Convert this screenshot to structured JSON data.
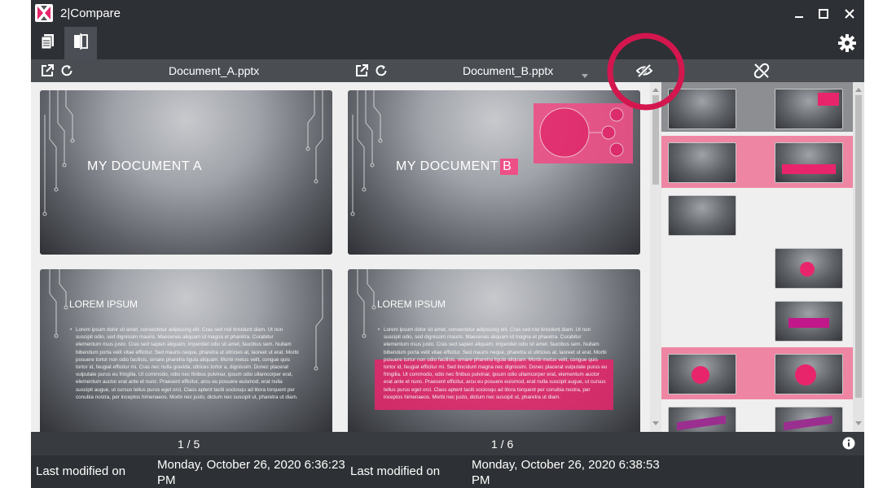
{
  "window": {
    "title": "2|Compare"
  },
  "toolbar": {
    "tabs": [
      "documents-tab",
      "compare-tab"
    ]
  },
  "left_doc": {
    "filename": "Document_A.pptx",
    "page": "1 / 5",
    "modified_label": "Last modified on",
    "modified_value": "Monday, October 26, 2020 6:36:23 PM",
    "slides": [
      {
        "title": "MY DOCUMENT A"
      },
      {
        "heading": "LOREM IPSUM",
        "body": "Lorem ipsum dolor sit amet, consectetur adipiscing elit. Cras sed nisl tincidunt diam. Ut non suscipit odio, sed dignissim mauris. Maecenas aliquam id magna et pharetra. Curabitur elementum risus justo. Cras sed sapien aliquam, imperdiet odio sit amet, faucibus sem. Nullam bibendum porta velit vitae efficitur. Sed mauris neque, pharetra ut ultricies at, laoreet ut erat. Morbi posuere tortor non odio facilisis, ornare pharetra ligula aliquam. Morbi metus velit, congue quis tortor id, feugiat efficitur mi. Cras nec nulla gravida, ultrices tortor a, dignissim. Donec placerat vulputate purus eu fringilla. Ut commodo, odio nec finibus pulvinar, ipsum odio ullamcorper erat, elementum auctor erat ante et nunc. Praesent efficitur, arcu eu posuere euismod, erat nulla suscipit augue, ut cursus tellus purus eget orci. Class aptent taciti sociosqu ad litora torquent per conubia nostra, per inceptos himenaeos. Morbi nec justo, dictum nec suscipit ut, pharetra ut diam."
      }
    ]
  },
  "right_doc": {
    "filename": "Document_B.pptx",
    "page": "1 / 6",
    "modified_label": "Last modified on",
    "modified_value": "Monday, October 26, 2020 6:38:53 PM",
    "slides": [
      {
        "title": "MY DOCUMENT",
        "title_suffix": "B"
      },
      {
        "heading": "LOREM IPSUM",
        "body": "Lorem ipsum dolor sit amet, consectetur adipiscing elit. Cras sed nisl tincidunt diam. Ut non suscipit odio, sed dignissim mauris. Maecenas aliquam id magna et pharetra. Curabitur elementum risus justo. Cras sed sapien aliquam, imperdiet odio sit amet, faucibus sem. Nullam bibendum porta velit vitae efficitur. Sed mauris neque, pharetra ut ultricies at, laoreet ut erat. Morbi posuere tortor non odio facilisis, ornare pharetra ligula aliquam. Morbi metus velit, congue quis tortor id, feugiat efficitur mi. Sed tincidunt magna nec dignissim. Donec placerat vulputate purus eu fringilla. Ut commodo, odio nec finibus pulvinar, ipsum odio ullamcorper erat, elementum auctor erat ante et nunc. Praesent efficitur, arcu eu posuere euismod, erat nulla suscipit augue, ut cursus tellus purus eget orci. Class aptent taciti sociosqu ad litora torquent per conubia nostra, per inceptos himenaeos. Morbi nec justo, dictum nec suscipit ut, pharetra ut diam."
      }
    ]
  },
  "colors": {
    "accent": "#e8256b",
    "highlight_row": "#ee85a3",
    "callout_ring": "#d4164f",
    "title_bg": "#2d3034",
    "status_bg": "#2d3034",
    "header_bg": "#4a4e53"
  },
  "icons": [
    "app-logo-icon",
    "minimize-icon",
    "maximize-icon",
    "close-icon",
    "documents-icon",
    "compare-icon",
    "settings-icon",
    "open-external-icon",
    "refresh-icon",
    "dropdown-icon",
    "hide-identical-icon",
    "unlink-scroll-icon",
    "info-icon"
  ]
}
